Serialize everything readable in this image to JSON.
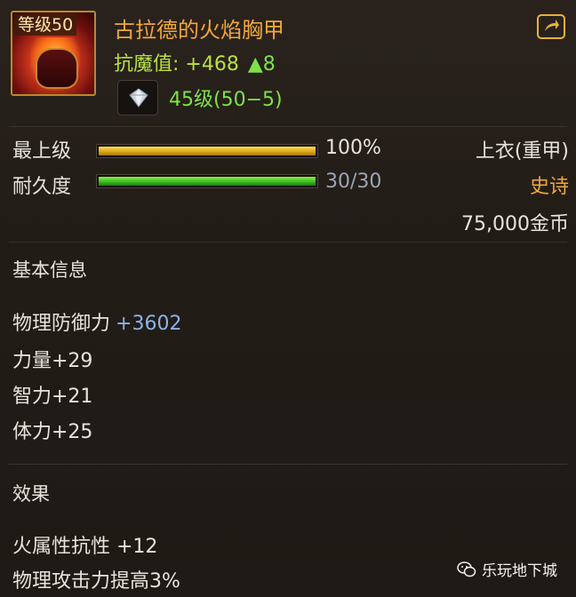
{
  "item": {
    "level_badge": "等级50",
    "name": "古拉德的火焰胸甲",
    "resist_text": "抗魔值: +468",
    "resist_up": "▲8",
    "gem_level": "45级(50−5)",
    "icon": "flame-chest-armor-icon"
  },
  "stats": {
    "upgrade_label": "最上级",
    "upgrade_pct": "100%",
    "upgrade_fraction": 1.0,
    "durability_label": "耐久度",
    "durability_value": "30/30",
    "durability_fraction": 1.0,
    "slot_type": "上衣(重甲)",
    "rarity": "史诗",
    "price": "75,000金币"
  },
  "basic": {
    "title": "基本信息",
    "lines": [
      {
        "label": "物理防御力",
        "value": "+3602"
      },
      {
        "label": "力量+29"
      },
      {
        "label": "智力+21"
      },
      {
        "label": "体力+25"
      }
    ]
  },
  "effects": {
    "title": "效果",
    "lines": [
      "火属性抗性 +12",
      "物理攻击力提高3%"
    ]
  },
  "watermark": "乐玩地下城",
  "colors": {
    "title": "#f0a63a",
    "resist": "#b8e040",
    "green": "#7fe04a",
    "rarity": "#f0a63a",
    "blue_value": "#8ab4e8"
  }
}
